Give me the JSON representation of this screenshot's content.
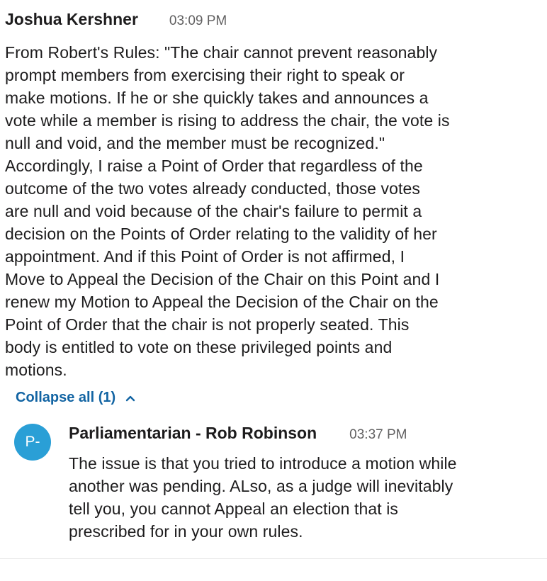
{
  "message": {
    "author": "Joshua Kershner",
    "time": "03:09 PM",
    "lines": [
      "From Robert's Rules: \"The chair cannot prevent reasonably",
      "prompt members from exercising their right to speak or",
      "make motions.  If he or she quickly takes and announces a",
      "vote while a member is rising to address the chair, the vote is",
      "null and void, and the member must be recognized.\"",
      "Accordingly, I raise a Point of Order that regardless of the",
      "outcome of the two votes already conducted, those votes",
      "are null and void because of the chair's failure to permit a",
      "decision on the Points of Order relating to the validity of her",
      "appointment.  And if this Point of Order is not affirmed, I",
      "Move to Appeal the Decision of the Chair on this Point and I",
      "renew my Motion to Appeal the Decision of the Chair on the",
      "Point of Order that the chair is not properly seated.  This",
      "body is entitled to vote on these privileged points and",
      "motions."
    ]
  },
  "thread": {
    "collapse_label": "Collapse all (1)",
    "chevron_icon": "chevron-up-icon"
  },
  "reply": {
    "avatar_initials": "P-",
    "avatar_color": "#2a9fd6",
    "author": "Parliamentarian - Rob Robinson",
    "time": "03:37 PM",
    "lines": [
      "The issue is that you tried to introduce a motion while",
      "another was pending. ALso, as a judge will inevitably",
      "tell you, you cannot Appeal an election that is",
      "prescribed for in your own rules."
    ]
  },
  "colors": {
    "link": "#1264a3",
    "timestamp": "#616061",
    "text": "#1d1c1d"
  }
}
